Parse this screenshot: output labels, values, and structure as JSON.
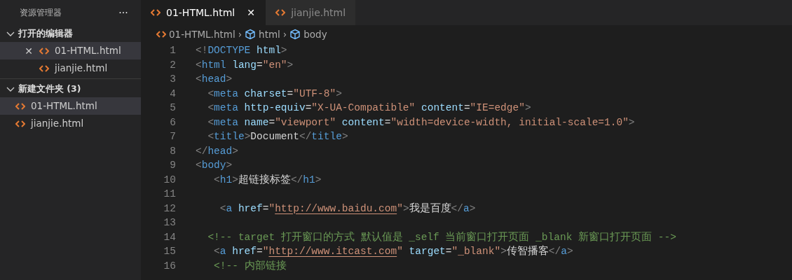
{
  "sidebar": {
    "title": "资源管理器",
    "more": "···",
    "sections": [
      {
        "title": "打开的编辑器",
        "expanded": true,
        "items": [
          {
            "label": "01-HTML.html",
            "selected": true,
            "close": "✕"
          },
          {
            "label": "jianjie.html",
            "selected": false
          }
        ]
      },
      {
        "title": "新建文件夹 (3)",
        "expanded": true,
        "items": [
          {
            "label": "01-HTML.html",
            "selected": true
          },
          {
            "label": "jianjie.html",
            "selected": false
          }
        ]
      }
    ]
  },
  "tabs": [
    {
      "label": "01-HTML.html",
      "selected": true,
      "close": "✕"
    },
    {
      "label": "jianjie.html",
      "selected": false
    }
  ],
  "breadcrumb": [
    {
      "kind": "file",
      "label": "01-HTML.html"
    },
    {
      "kind": "element",
      "separator": "›",
      "label": "html"
    },
    {
      "kind": "element",
      "separator": "›",
      "label": "body"
    }
  ],
  "code": [
    {
      "number": "1",
      "tokens": [
        {
          "kind": "punct",
          "text": "<!"
        },
        {
          "kind": "tag",
          "text": "DOCTYPE"
        },
        {
          "kind": "attr",
          "text": " html"
        },
        {
          "kind": "punct",
          "text": ">"
        }
      ]
    },
    {
      "number": "2",
      "tokens": [
        {
          "kind": "punct",
          "text": "<"
        },
        {
          "kind": "tag",
          "text": "html"
        },
        {
          "kind": "attr",
          "text": " lang"
        },
        {
          "kind": "text",
          "text": "="
        },
        {
          "kind": "string",
          "text": "\"en\""
        },
        {
          "kind": "punct",
          "text": ">"
        }
      ]
    },
    {
      "number": "3",
      "tokens": [
        {
          "kind": "punct",
          "text": "<"
        },
        {
          "kind": "tag",
          "text": "head"
        },
        {
          "kind": "punct",
          "text": ">"
        }
      ]
    },
    {
      "number": "4",
      "tokens": [
        {
          "kind": "punct",
          "text": "  <"
        },
        {
          "kind": "tag",
          "text": "meta"
        },
        {
          "kind": "attr",
          "text": " charset"
        },
        {
          "kind": "text",
          "text": "="
        },
        {
          "kind": "string",
          "text": "\"UTF-8\""
        },
        {
          "kind": "punct",
          "text": ">"
        }
      ]
    },
    {
      "number": "5",
      "tokens": [
        {
          "kind": "punct",
          "text": "  <"
        },
        {
          "kind": "tag",
          "text": "meta"
        },
        {
          "kind": "attr",
          "text": " http-equiv"
        },
        {
          "kind": "text",
          "text": "="
        },
        {
          "kind": "string",
          "text": "\"X-UA-Compatible\""
        },
        {
          "kind": "attr",
          "text": " content"
        },
        {
          "kind": "text",
          "text": "="
        },
        {
          "kind": "string",
          "text": "\"IE=edge\""
        },
        {
          "kind": "punct",
          "text": ">"
        }
      ]
    },
    {
      "number": "6",
      "tokens": [
        {
          "kind": "punct",
          "text": "  <"
        },
        {
          "kind": "tag",
          "text": "meta"
        },
        {
          "kind": "attr",
          "text": " name"
        },
        {
          "kind": "text",
          "text": "="
        },
        {
          "kind": "string",
          "text": "\"viewport\""
        },
        {
          "kind": "attr",
          "text": " content"
        },
        {
          "kind": "text",
          "text": "="
        },
        {
          "kind": "string",
          "text": "\"width=device-width, initial-scale=1.0\""
        },
        {
          "kind": "punct",
          "text": ">"
        }
      ]
    },
    {
      "number": "7",
      "tokens": [
        {
          "kind": "punct",
          "text": "  <"
        },
        {
          "kind": "tag",
          "text": "title"
        },
        {
          "kind": "punct",
          "text": ">"
        },
        {
          "kind": "text",
          "text": "Document"
        },
        {
          "kind": "punct",
          "text": "</"
        },
        {
          "kind": "tag",
          "text": "title"
        },
        {
          "kind": "punct",
          "text": ">"
        }
      ]
    },
    {
      "number": "8",
      "tokens": [
        {
          "kind": "punct",
          "text": "</"
        },
        {
          "kind": "tag",
          "text": "head"
        },
        {
          "kind": "punct",
          "text": ">"
        }
      ]
    },
    {
      "number": "9",
      "tokens": [
        {
          "kind": "punct",
          "text": "<"
        },
        {
          "kind": "tag",
          "text": "body"
        },
        {
          "kind": "punct",
          "text": ">"
        }
      ]
    },
    {
      "number": "10",
      "tokens": [
        {
          "kind": "punct",
          "text": "   <"
        },
        {
          "kind": "tag",
          "text": "h1"
        },
        {
          "kind": "punct",
          "text": ">"
        },
        {
          "kind": "text",
          "text": "超链接标签"
        },
        {
          "kind": "punct",
          "text": "</"
        },
        {
          "kind": "tag",
          "text": "h1"
        },
        {
          "kind": "punct",
          "text": ">"
        }
      ]
    },
    {
      "number": "11"
    },
    {
      "number": "12",
      "tokens": [
        {
          "kind": "punct",
          "text": "    <"
        },
        {
          "kind": "tag",
          "text": "a"
        },
        {
          "kind": "attr",
          "text": " href"
        },
        {
          "kind": "text",
          "text": "="
        },
        {
          "kind": "string",
          "text": "\""
        },
        {
          "kind": "link",
          "text": "http://www.baidu.com"
        },
        {
          "kind": "string",
          "text": "\""
        },
        {
          "kind": "punct",
          "text": ">"
        },
        {
          "kind": "text",
          "text": "我是百度"
        },
        {
          "kind": "punct",
          "text": "</"
        },
        {
          "kind": "tag",
          "text": "a"
        },
        {
          "kind": "punct",
          "text": ">"
        }
      ]
    },
    {
      "number": "13"
    },
    {
      "number": "14",
      "tokens": [
        {
          "kind": "comment",
          "text": "  <!-- target 打开窗口的方式 默认值是 _self 当前窗口打开页面 _blank 新窗口打开页面 -->"
        }
      ]
    },
    {
      "number": "15",
      "tokens": [
        {
          "kind": "punct",
          "text": "   <"
        },
        {
          "kind": "tag",
          "text": "a"
        },
        {
          "kind": "attr",
          "text": " href"
        },
        {
          "kind": "text",
          "text": "="
        },
        {
          "kind": "string",
          "text": "\""
        },
        {
          "kind": "link",
          "text": "http://www.itcast.com"
        },
        {
          "kind": "string",
          "text": "\""
        },
        {
          "kind": "attr",
          "text": " target"
        },
        {
          "kind": "text",
          "text": "="
        },
        {
          "kind": "string",
          "text": "\"_blank\""
        },
        {
          "kind": "punct",
          "text": ">"
        },
        {
          "kind": "text",
          "text": "传智播客"
        },
        {
          "kind": "punct",
          "text": "</"
        },
        {
          "kind": "tag",
          "text": "a"
        },
        {
          "kind": "punct",
          "text": ">"
        }
      ]
    },
    {
      "number": "16",
      "tokens": [
        {
          "kind": "comment",
          "text": "   <!-- 内部链接"
        }
      ]
    }
  ]
}
